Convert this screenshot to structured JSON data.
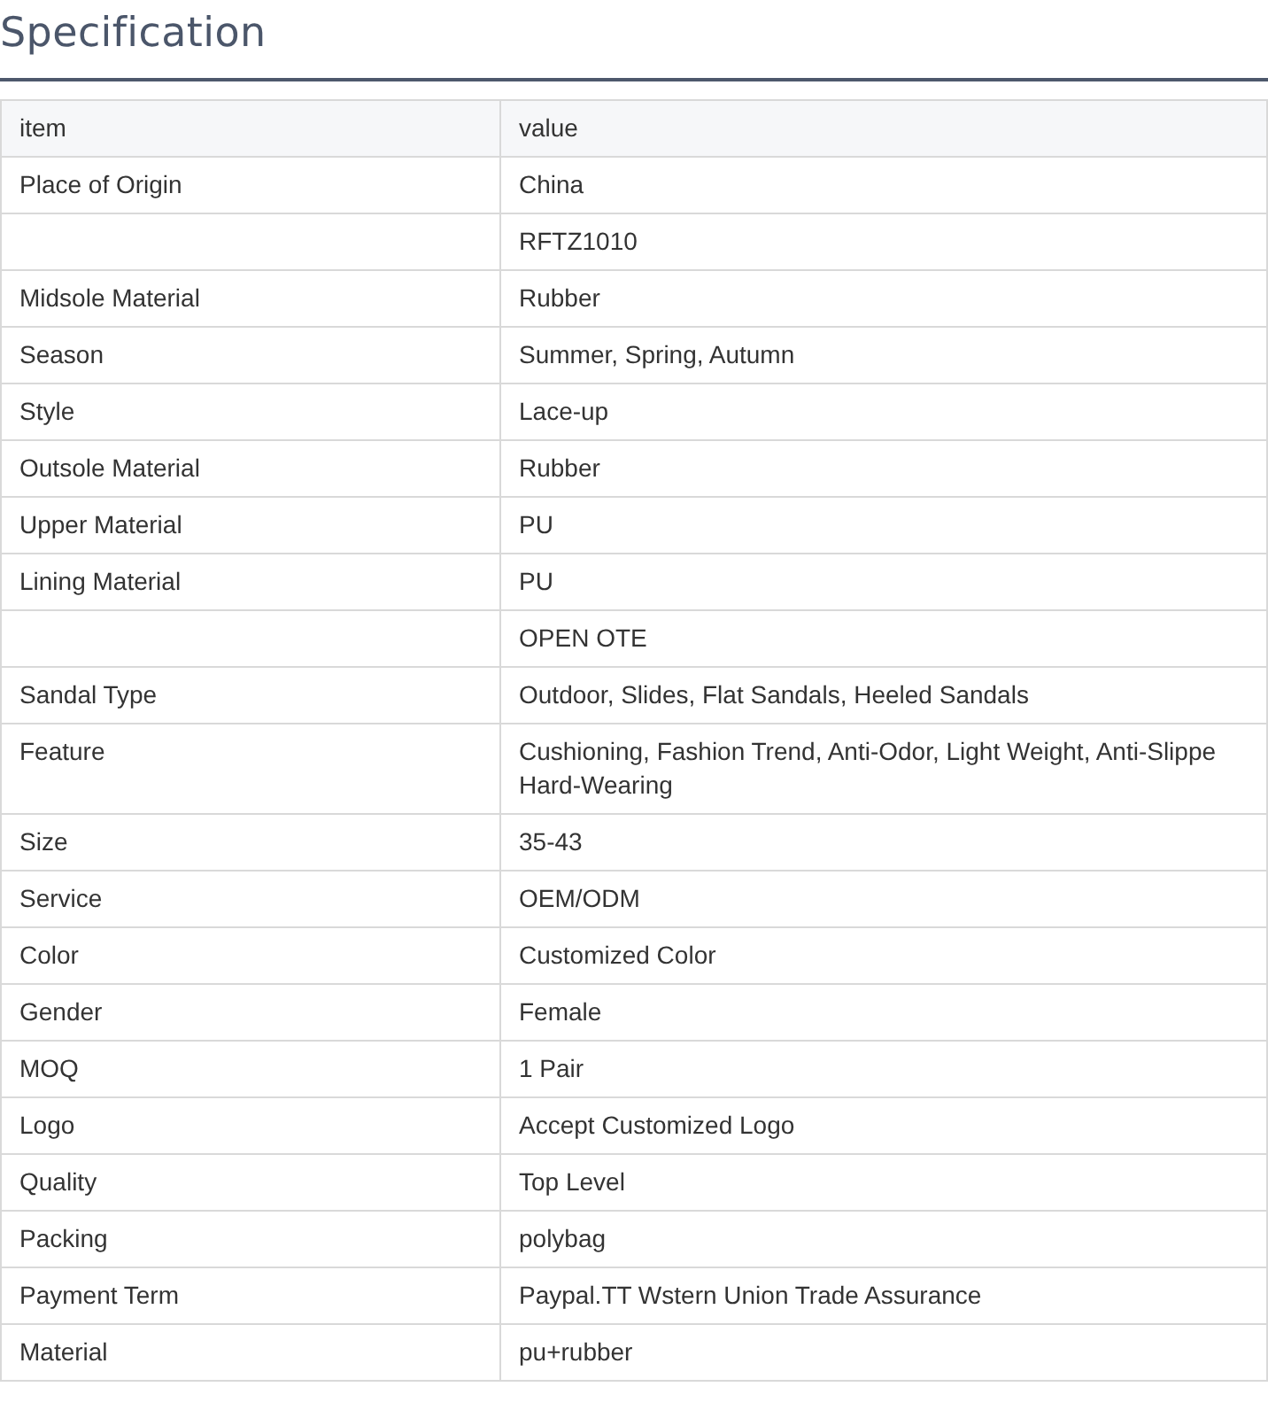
{
  "title": "Specification",
  "table": {
    "columns": [
      "item",
      "value"
    ],
    "rows": [
      {
        "item": "Place of Origin",
        "value": [
          "China"
        ]
      },
      {
        "item": "",
        "value": [
          "RFTZ1010"
        ]
      },
      {
        "item": "Midsole Material",
        "value": [
          "Rubber"
        ]
      },
      {
        "item": "Season",
        "value": [
          "Summer, Spring, Autumn"
        ]
      },
      {
        "item": "Style",
        "value": [
          "Lace-up"
        ]
      },
      {
        "item": "Outsole Material",
        "value": [
          "Rubber"
        ]
      },
      {
        "item": "Upper Material",
        "value": [
          "PU"
        ]
      },
      {
        "item": "Lining Material",
        "value": [
          "PU"
        ]
      },
      {
        "item": "",
        "value": [
          "OPEN OTE"
        ]
      },
      {
        "item": "Sandal Type",
        "value": [
          "Outdoor, Slides, Flat Sandals, Heeled Sandals"
        ]
      },
      {
        "item": "Feature",
        "value": [
          "Cushioning, Fashion Trend, Anti-Odor, Light Weight, Anti-Slippe",
          "Hard-Wearing"
        ]
      },
      {
        "item": "Size",
        "value": [
          "35-43"
        ]
      },
      {
        "item": "Service",
        "value": [
          "OEM/ODM"
        ]
      },
      {
        "item": "Color",
        "value": [
          "Customized Color"
        ]
      },
      {
        "item": "Gender",
        "value": [
          "Female"
        ]
      },
      {
        "item": "MOQ",
        "value": [
          "1 Pair"
        ]
      },
      {
        "item": "Logo",
        "value": [
          "Accept Customized Logo"
        ]
      },
      {
        "item": "Quality",
        "value": [
          "Top Level"
        ]
      },
      {
        "item": "Packing",
        "value": [
          "polybag"
        ]
      },
      {
        "item": "Payment Term",
        "value": [
          "Paypal.TT Wstern Union Trade Assurance"
        ]
      },
      {
        "item": "Material",
        "value": [
          "pu+rubber"
        ]
      }
    ]
  }
}
